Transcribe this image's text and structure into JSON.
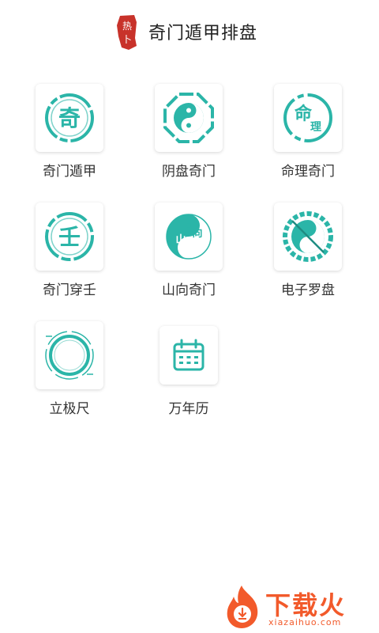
{
  "header": {
    "title": "奇门遁甲排盘",
    "logo_text": "热卜"
  },
  "tiles": [
    {
      "label": "奇门遁甲",
      "icon": "qi-character-icon",
      "glyph": "奇"
    },
    {
      "label": "阴盘奇门",
      "icon": "yin-yang-bagua-icon"
    },
    {
      "label": "命理奇门",
      "icon": "mingli-character-icon",
      "glyph": "命",
      "glyph2": "理"
    },
    {
      "label": "奇门穿壬",
      "icon": "ren-character-icon",
      "glyph": "壬"
    },
    {
      "label": "山向奇门",
      "icon": "shan-xiang-yin-yang-icon",
      "glyph": "山",
      "glyph2": "向"
    },
    {
      "label": "电子罗盘",
      "icon": "compass-bagua-icon"
    },
    {
      "label": "立极尺",
      "icon": "ring-ruler-icon"
    },
    {
      "label": "万年历",
      "icon": "calendar-icon"
    }
  ],
  "watermark": {
    "text": "下载火",
    "url": "xiazaihuo.com"
  },
  "colors": {
    "accent": "#2bb5a8",
    "logo_red": "#c8322a",
    "watermark_orange": "#f25a2b"
  }
}
